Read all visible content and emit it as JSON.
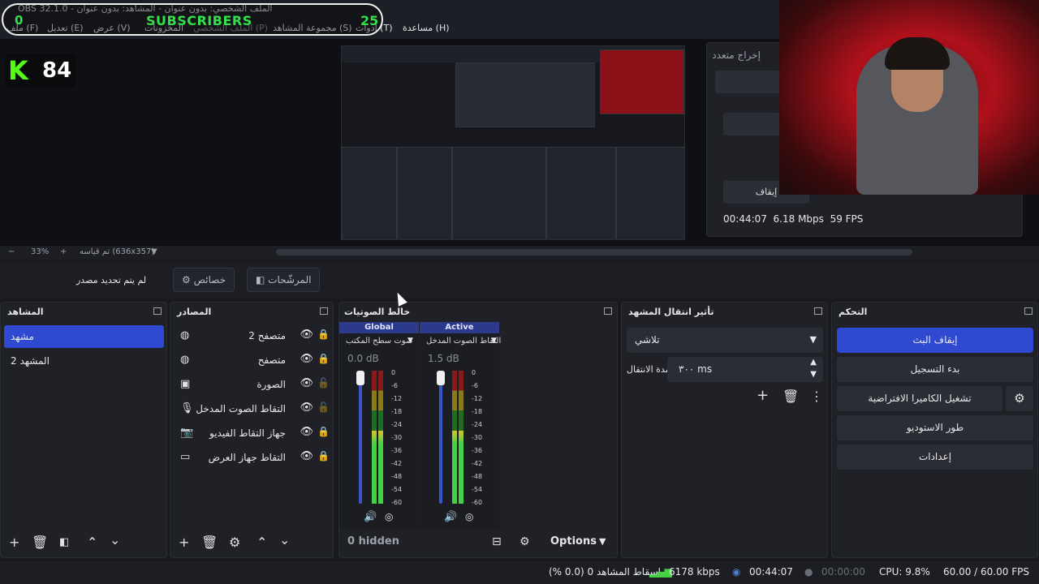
{
  "window": {
    "title": "OBS 32.1.0 - الملف الشخصي: بدون عنوان - المشاهد: بدون عنوان"
  },
  "overlay": {
    "subs_current": "0",
    "subs_label": "SUBSCRIBERS",
    "subs_goal": "25",
    "kick_count": "84",
    "kick_logo": "K"
  },
  "menu": {
    "items": [
      "ملف (F)",
      "تعديل (E)",
      "عرض (V)",
      "المخزونات",
      "الملف الشخصي (P)",
      "مجموعة المشاهد (S)",
      "أدوات (T)",
      "مساعدة (H)"
    ]
  },
  "multi_output": {
    "title": "إخراج متعدد",
    "stop_button": "إيقاف",
    "stats_time": "00:44:07",
    "stats_bitrate": "6.18 Mbps",
    "stats_fps": "59 FPS"
  },
  "zoom": {
    "minus": "−",
    "level": "33%",
    "plus": "+",
    "scale_note": "تم قياسه (636x357)"
  },
  "source_bar": {
    "no_source": "لم يتم تحديد مصدر",
    "properties": "خصائص",
    "filters": "المرشّحات"
  },
  "scenes": {
    "title": "المشاهد",
    "items": [
      "مشهد",
      "المشهد 2"
    ]
  },
  "sources": {
    "title": "المصادر",
    "items": [
      {
        "label": "متصفح 2",
        "icon": "globe-icon"
      },
      {
        "label": "متصفح",
        "icon": "globe-icon"
      },
      {
        "label": "الصورة",
        "icon": "image-icon"
      },
      {
        "label": "التقاط الصوت المدخل",
        "icon": "microphone-icon"
      },
      {
        "label": "جهاز التقاط الفيديو",
        "icon": "camera-icon"
      },
      {
        "label": "التقاط جهاز العرض",
        "icon": "monitor-icon"
      }
    ]
  },
  "mixer": {
    "title": "خالط الصوتيات",
    "channels": [
      {
        "tag": "Global",
        "source": "صوت سطح المكتب",
        "db": "0.0 dB",
        "level": 0.55
      },
      {
        "tag": "Active",
        "source": "التقاط الصوت المدخل",
        "db": "1.5 dB",
        "level": 0.55
      }
    ],
    "scale": [
      "0",
      "-6",
      "-12",
      "-18",
      "-24",
      "-30",
      "-36",
      "-42",
      "-48",
      "-54",
      "-60"
    ],
    "hidden": "0 hidden",
    "options": "Options"
  },
  "transitions": {
    "title": "تأثير انتقال المشهد",
    "type": "تلاشي",
    "duration_label": "مدة الانتقال",
    "duration_value": "٣٠٠ ms"
  },
  "controls": {
    "title": "التحكم",
    "stop_stream": "إيقاف البث",
    "start_recording": "بدء التسجيل",
    "virtual_camera": "تشغيل الكاميرا الافتراضية",
    "studio_mode": "طور الاستوديو",
    "settings": "إعدادات"
  },
  "status": {
    "dropped": "إسقاط المشاهد 0 (0.0 %)",
    "bitrate": "6178 kbps",
    "stream_time": "00:44:07",
    "rec_time": "00:00:00",
    "cpu": "CPU: 9.8%",
    "fps": "60.00 / 60.00 FPS"
  },
  "colors": {
    "accent": "#2f49d1",
    "meter_green": "#45d045",
    "kick_green": "#53fc18"
  }
}
